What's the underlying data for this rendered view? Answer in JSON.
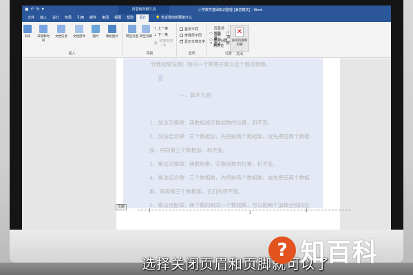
{
  "window": {
    "context_tab_title": "页眉和页脚工具",
    "doc_title": "小学数学基础知识整理 [兼容模式] - Word"
  },
  "tabs": [
    {
      "label": "文件"
    },
    {
      "label": "插入"
    },
    {
      "label": "设计"
    },
    {
      "label": "布局"
    },
    {
      "label": "引用"
    },
    {
      "label": "邮件"
    },
    {
      "label": "审阅"
    },
    {
      "label": "视图"
    },
    {
      "label": "帮助"
    },
    {
      "label": "设计"
    }
  ],
  "tell_me": "告诉我你想要做什么",
  "ribbon": {
    "insert_group": {
      "label": "插入",
      "buttons": [
        "页码",
        "日期和时间",
        "文档信息",
        "文档部件",
        "图片",
        "联机图片"
      ]
    },
    "nav_group": {
      "label": "导航",
      "goto_header": "转至页眉",
      "goto_footer": "转至页脚",
      "prev": "上一条",
      "next": "下一条",
      "link_prev": "链接到前一节"
    },
    "options_group": {
      "label": "选项",
      "first_page": "首页不同",
      "odd_even": "奇偶页不同",
      "show_text": "显示文档文字"
    },
    "position_group": {
      "label": "位置",
      "header_top": "页眉顶端距离:",
      "header_top_value": "1.5 厘米",
      "footer_bottom": "页脚底端距离:",
      "footer_bottom_value": "1.75 厘米",
      "insert_tab": "插入对齐制表位"
    },
    "close_group": {
      "label": "关闭",
      "close_btn": "关闭页眉和页脚"
    }
  },
  "document": {
    "lines": [
      "分数的除法则：除以一个数等于乘以这个数的倒数。",
      "一、算术方面",
      "1、加法交换律：两数相加交换加数的位置，和不变。",
      "2、加法结合律：三个数相加，先把前两个数相加，或先把后两个数相",
      "加，再同第三个数相加，和不变。",
      "3、乘法交换律：两数相乘，交换因数的位置，积不变。",
      "4、乘法结合律：三个数相乘，先把前两个数相乘，或先把后两个数相",
      "乘，再和第三个数相乘，它们的积不变。",
      "5、乘法分配律：两个数的和同一个数相乘，可以把两个加数分别同这"
    ],
    "footer_tag": "页脚",
    "page_number": "1"
  },
  "overlay": {
    "subtitle": "选择关闭页眉和页脚就可以了",
    "watermark_mark": "?",
    "watermark_text": "知百科"
  },
  "colors": {
    "word_blue": "#2b579a",
    "selection": "#e4e9f5",
    "watermark_orange": "#e2531f"
  }
}
